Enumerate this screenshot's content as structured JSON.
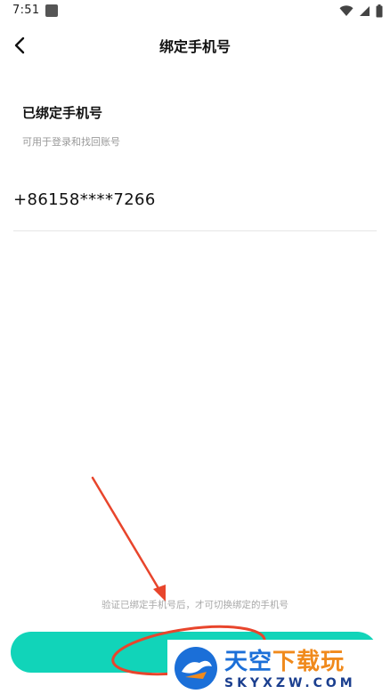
{
  "status_bar": {
    "time": "7:51"
  },
  "header": {
    "title": "绑定手机号"
  },
  "section": {
    "title": "已绑定手机号",
    "subtitle": "可用于登录和找回账号",
    "phone": "+86158****7266"
  },
  "footer": {
    "hint": "验证已绑定手机号后，才可切换绑定的手机号",
    "button_label": ""
  },
  "watermark": {
    "brand_part1": "天空",
    "brand_part2": "下载玩",
    "url": "SKYXZW.COM"
  },
  "colors": {
    "accent": "#11d4b9",
    "annotation": "#e8452c",
    "watermark_blue": "#1b6fd8",
    "watermark_orange": "#f08a1c"
  },
  "icons": [
    "notification-icon",
    "wifi-icon",
    "signal-icon",
    "battery-icon",
    "back-arrow-icon"
  ]
}
